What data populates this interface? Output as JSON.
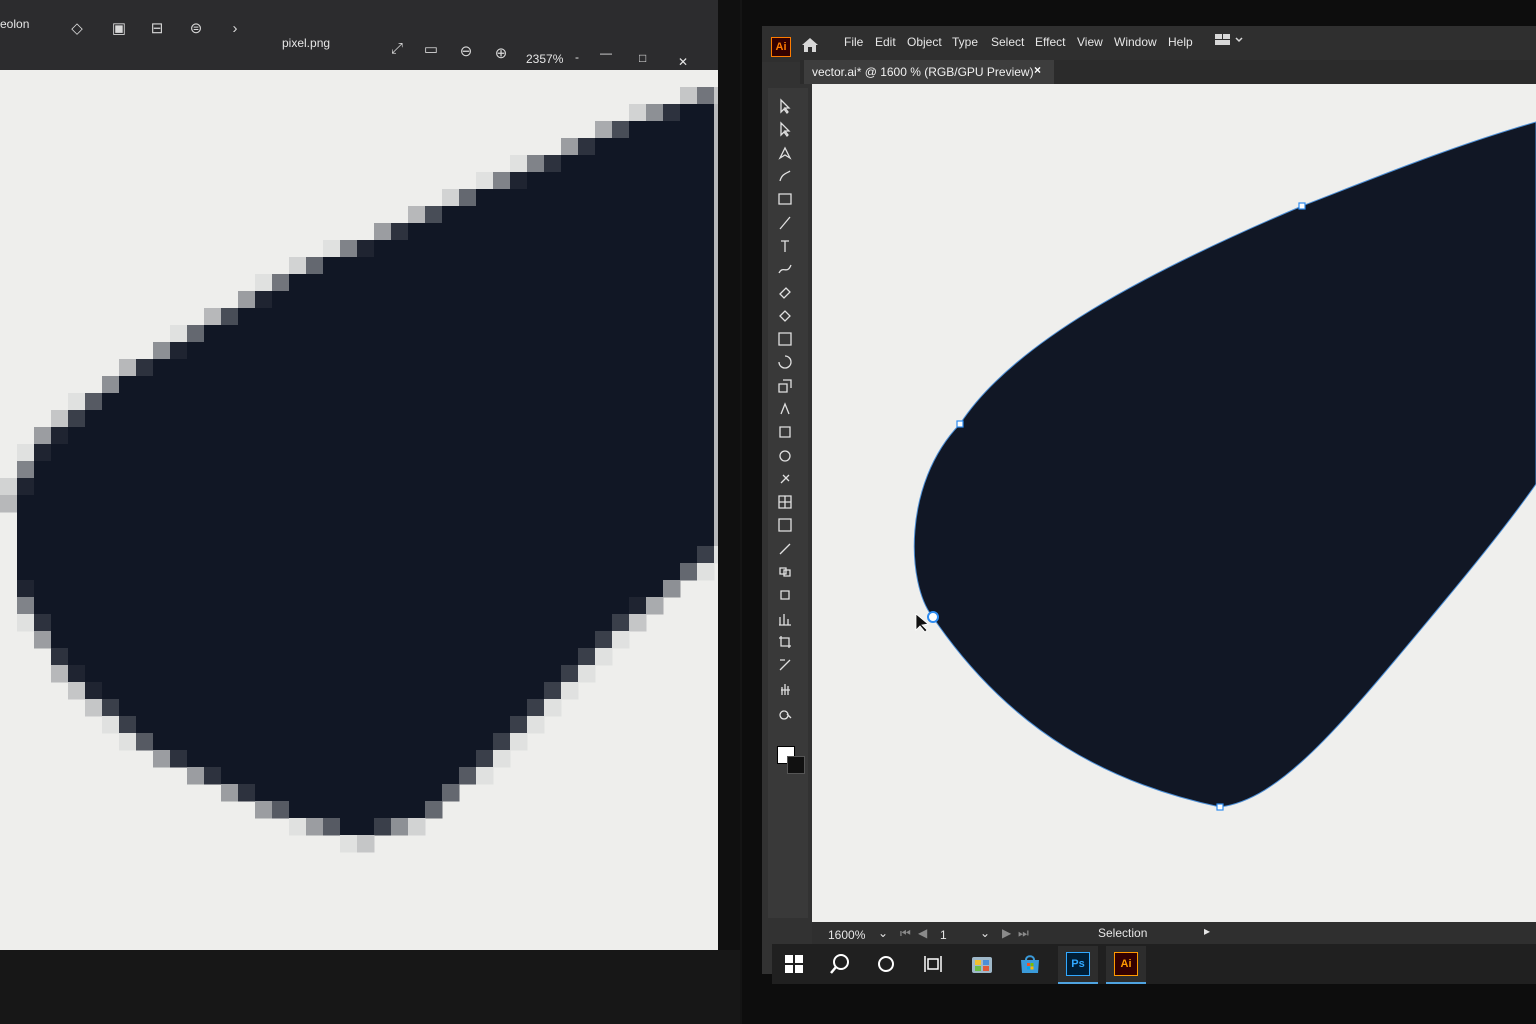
{
  "left_viewer": {
    "app_label": "eolon",
    "file_name": "pixel.png",
    "zoom": "2357%",
    "zoom_caret": "-",
    "minimize": "—",
    "maximize": "□",
    "close": "✕"
  },
  "illustrator": {
    "logo": "Ai",
    "menu": [
      "File",
      "Edit",
      "Object",
      "Type",
      "Select",
      "Effect",
      "View",
      "Window",
      "Help"
    ],
    "document_tab": "vector.ai* @ 1600 % (RGB/GPU Preview)",
    "document_tab_close": "×",
    "status": {
      "zoom": "1600%",
      "artboard": "1",
      "current_tool": "Selection"
    }
  },
  "taskbar": {
    "apps": [
      {
        "name": "start",
        "icon": "windows-icon"
      },
      {
        "name": "search",
        "icon": "search-icon"
      },
      {
        "name": "cortana",
        "icon": "circle-icon"
      },
      {
        "name": "task-view",
        "icon": "task-view-icon"
      },
      {
        "name": "files",
        "icon": "file-explorer-icon"
      },
      {
        "name": "store",
        "icon": "store-icon"
      },
      {
        "name": "photoshop",
        "label": "Ps",
        "active": true
      },
      {
        "name": "illustrator",
        "label": "Ai",
        "active": true
      }
    ]
  },
  "colors": {
    "shape_fill": "#111725",
    "canvas_bg": "#efefed",
    "anchor_blue": "#2f8cf0"
  }
}
